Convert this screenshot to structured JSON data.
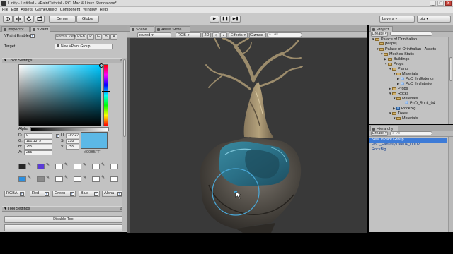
{
  "window": {
    "title": "Unity - Untitled - VPaintTutorial - PC, Mac & Linux Standalone*",
    "controls": [
      "_",
      "□",
      "×"
    ]
  },
  "menu": [
    "File",
    "Edit",
    "Assets",
    "GameObject",
    "Component",
    "Window",
    "Help"
  ],
  "toolbar": {
    "tools": [
      "hand",
      "move",
      "rotate",
      "scale"
    ],
    "pivot": "Center",
    "space": "Global",
    "play_controls": [
      "▶",
      "❚❚",
      "▶❚"
    ],
    "layers": "Layers",
    "layout": "big"
  },
  "inspector": {
    "tabs": [
      "Inspector",
      "VPaint"
    ],
    "vpaint_enabled": "VPaint Enabled",
    "modes": [
      "Normal View",
      "RGB",
      "R",
      "G",
      "B",
      "A"
    ],
    "target_label": "Target",
    "target_value": "New VPaint Group",
    "color_settings": "Color Settings",
    "alpha_label": "Alpha",
    "r": "R:",
    "r_val": "0",
    "g": "G:",
    "g_val": "181.1379",
    "b": "B:",
    "b_val": "255",
    "a": "A:",
    "a_val": "255",
    "h": "H:",
    "h_val": "197.37",
    "s": "S:",
    "s_val": "255",
    "v": "V:",
    "v_val": "255",
    "hex": "#00B5FF",
    "swatch_color": "#5cb8e6",
    "preset_colors": [
      "#262626",
      "#5b3bd6",
      "#ffffff",
      "#ffffff",
      "#ffffff",
      "#ffffff",
      "#2b8fe0",
      "#8a8a8a",
      "#ffffff",
      "#ffffff",
      "#ffffff",
      "#ffffff"
    ],
    "channel_buttons": [
      "RGBA",
      "Red",
      "Green",
      "Blue",
      "Alpha"
    ],
    "tool_settings": "Tool Settings",
    "disable_tool": "Disable Tool"
  },
  "scene": {
    "tabs": [
      "Scene",
      "Asset Store"
    ],
    "shading": "xtured",
    "render_mode": "RGB",
    "toggle_2d": "2D",
    "effects": "Effects",
    "gizmos": "Gizmos",
    "search_placeholder": "All"
  },
  "project": {
    "tab": "Project",
    "create": "Create",
    "search_placeholder": "",
    "items": [
      {
        "label": "Palace of Orinthalian",
        "icon": "folder",
        "arrow": "▼"
      },
      {
        "label": "[Maps]",
        "icon": "folder",
        "arrow": ""
      },
      {
        "label": "Palace of Orinthalian - Assets",
        "icon": "folder",
        "arrow": "▼"
      },
      {
        "label": "Meshes-Static",
        "icon": "folder",
        "arrow": "▼"
      },
      {
        "label": "Buildings",
        "icon": "folder",
        "arrow": "▶"
      },
      {
        "label": "Props",
        "icon": "folder",
        "arrow": "▼"
      },
      {
        "label": "Plants",
        "icon": "folder",
        "arrow": "▼"
      },
      {
        "label": "Materials",
        "icon": "folder",
        "arrow": "▼"
      },
      {
        "label": "PoO_IvyExterior",
        "icon": "material",
        "arrow": "▶"
      },
      {
        "label": "PoO_IvyInterior",
        "icon": "material",
        "arrow": "▶"
      },
      {
        "label": "Props",
        "icon": "folder",
        "arrow": "▶"
      },
      {
        "label": "Rocks",
        "icon": "folder",
        "arrow": "▼"
      },
      {
        "label": "Materials",
        "icon": "folder",
        "arrow": "▼"
      },
      {
        "label": "PoO_Rock_04",
        "icon": "material",
        "arrow": ""
      },
      {
        "label": "RockBig",
        "icon": "mesh",
        "arrow": "▶"
      },
      {
        "label": "Trees",
        "icon": "folder",
        "arrow": "▼"
      },
      {
        "label": "Materials",
        "icon": "folder",
        "arrow": "▼"
      }
    ]
  },
  "hierarchy": {
    "tab": "Hierarchy",
    "create": "Create",
    "search_placeholder": "All",
    "items": [
      "New VPaint Group",
      "PoO_FantasyTree04_LOD2",
      "RockBig"
    ]
  }
}
